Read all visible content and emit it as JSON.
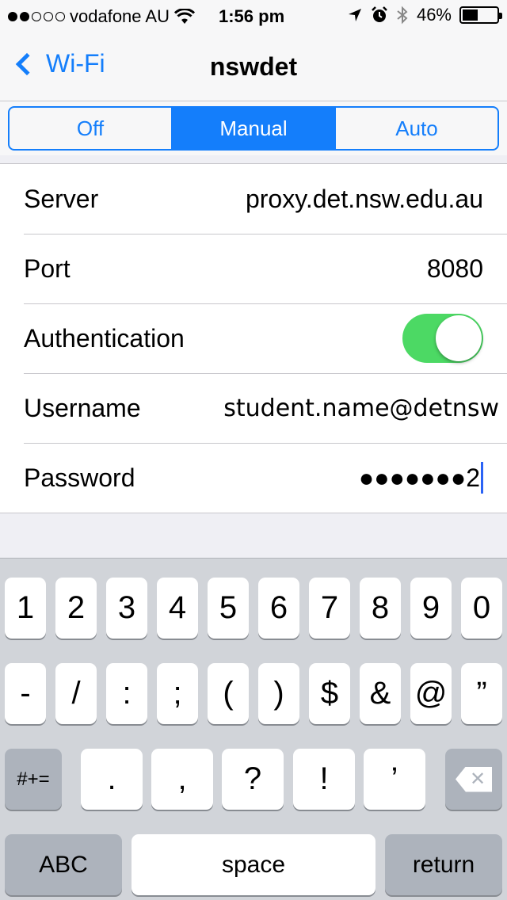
{
  "status_bar": {
    "signal_filled": 2,
    "signal_total": 5,
    "carrier": "vodafone AU",
    "time": "1:56 pm",
    "battery_percent": "46%",
    "battery_level": 0.46
  },
  "nav": {
    "back_label": "Wi-Fi",
    "title": "nswdet"
  },
  "proxy_mode": {
    "options": [
      "Off",
      "Manual",
      "Auto"
    ],
    "selected": "Manual"
  },
  "fields": {
    "server_label": "Server",
    "server_value": "proxy.det.nsw.edu.au",
    "port_label": "Port",
    "port_value": "8080",
    "auth_label": "Authentication",
    "auth_enabled": true,
    "username_label": "Username",
    "username_value": "student.name@detnsw",
    "password_label": "Password",
    "password_masked": "●●●●●●●",
    "password_last_char": "2"
  },
  "keyboard": {
    "row1": [
      "1",
      "2",
      "3",
      "4",
      "5",
      "6",
      "7",
      "8",
      "9",
      "0"
    ],
    "row2": [
      "-",
      "/",
      ":",
      ";",
      "(",
      ")",
      "$",
      "&",
      "@",
      "”"
    ],
    "row3_mode": "#+=",
    "row3": [
      ".",
      ",",
      "?",
      "!",
      "’"
    ],
    "abc": "ABC",
    "space": "space",
    "return": "return"
  },
  "colors": {
    "accent": "#147efb",
    "toggle_on": "#4cd964"
  }
}
